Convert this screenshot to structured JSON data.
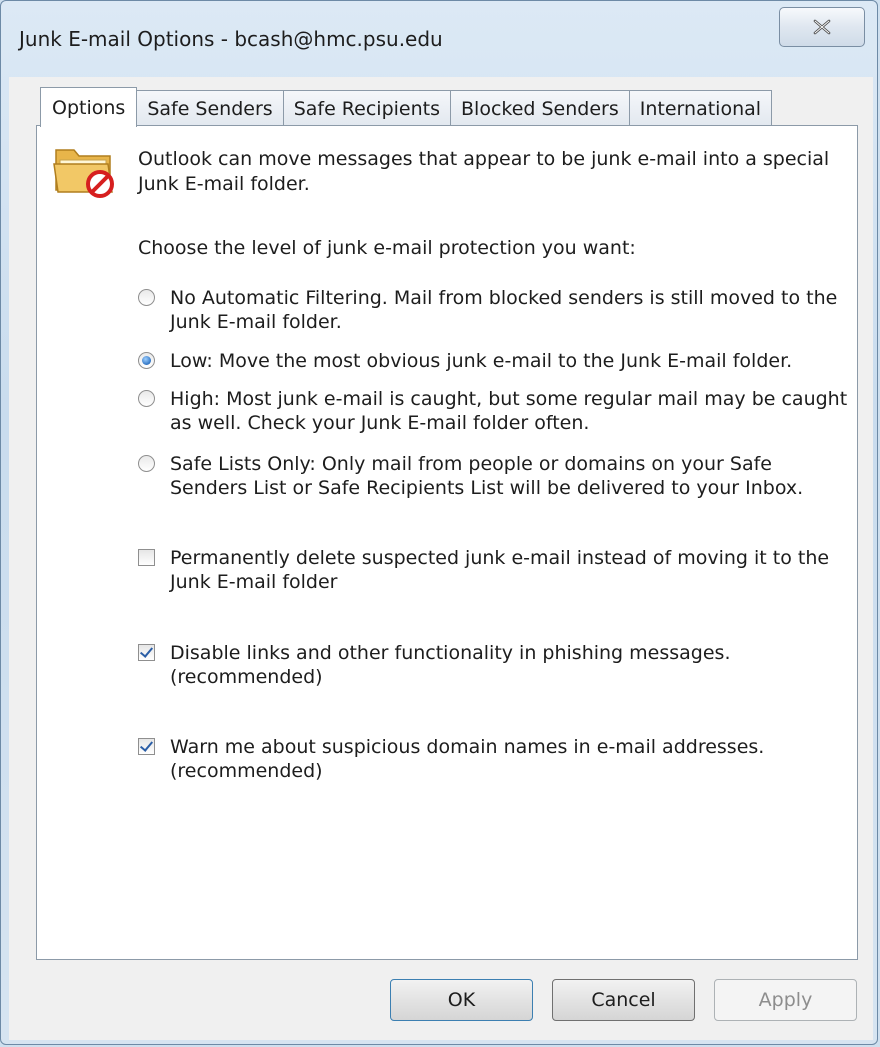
{
  "window": {
    "title": "Junk E-mail Options - bcash@hmc.psu.edu",
    "close_icon": "close-icon"
  },
  "tabs": [
    {
      "label": "Options",
      "active": true
    },
    {
      "label": "Safe Senders",
      "active": false
    },
    {
      "label": "Safe Recipients",
      "active": false
    },
    {
      "label": "Blocked Senders",
      "active": false
    },
    {
      "label": "International",
      "active": false
    }
  ],
  "intro": {
    "line1": "Outlook can move messages that appear to be junk e-mail into a special",
    "line2": "Junk E-mail folder.",
    "icon": "junk-folder-icon"
  },
  "prompt": "Choose the level of junk e-mail protection you want:",
  "levels": [
    {
      "line1": "No Automatic Filtering. Mail from blocked senders is still moved to the",
      "line2": "Junk E-mail folder.",
      "checked": false
    },
    {
      "line1": "Low: Move the most obvious junk e-mail to the Junk E-mail folder.",
      "line2": "",
      "checked": true
    },
    {
      "line1": "High: Most junk e-mail is caught, but some regular mail may be caught",
      "line2": "as well. Check your Junk E-mail folder often.",
      "checked": false
    },
    {
      "line1": "Safe Lists Only: Only mail from people or domains on your Safe",
      "line2": "Senders List or Safe Recipients List will be delivered to your Inbox.",
      "checked": false
    }
  ],
  "checkboxes": [
    {
      "line1": "Permanently delete suspected junk e-mail instead of moving it to the",
      "line2": "Junk E-mail folder",
      "checked": false
    },
    {
      "line1": "Disable links and other functionality in phishing messages.",
      "line2": "(recommended)",
      "checked": true
    },
    {
      "line1": "Warn me about suspicious domain names in e-mail addresses.",
      "line2": "(recommended)",
      "checked": true
    }
  ],
  "buttons": {
    "ok": "OK",
    "cancel": "Cancel",
    "apply": "Apply"
  },
  "colors": {
    "accent": "#2f74c4",
    "disabled_text": "#8d8d8d"
  }
}
